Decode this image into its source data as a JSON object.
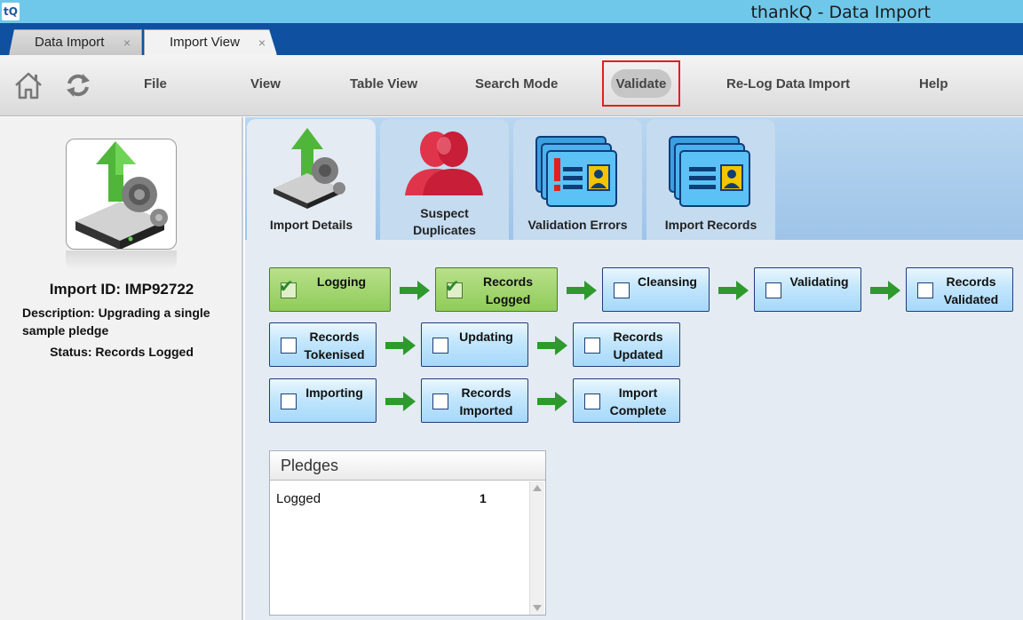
{
  "window": {
    "logo_text": "tQ",
    "title": "thankQ - Data Import"
  },
  "doc_tabs": [
    {
      "label": "Data Import",
      "close": "×"
    },
    {
      "label": "Import View",
      "close": "×"
    }
  ],
  "menu": {
    "items": {
      "file": "File",
      "view": "View",
      "table_view": "Table View",
      "search_mode": "Search Mode",
      "validate": "Validate",
      "relog": "Re-Log Data Import",
      "help": "Help"
    },
    "icons": [
      "home-icon",
      "refresh-icon"
    ]
  },
  "import": {
    "id_line": "Import ID: IMP92722",
    "description_line1": "Description: Upgrading a single",
    "description_line2": "sample pledge",
    "status_line": "Status: Records Logged"
  },
  "view_tabs": [
    {
      "label": "Import Details",
      "icon": "import-details-icon"
    },
    {
      "label1": "Suspect",
      "label2": "Duplicates",
      "icon": "suspect-duplicates-icon"
    },
    {
      "label": "Validation Errors",
      "icon": "validation-errors-icon"
    },
    {
      "label": "Import Records",
      "icon": "import-records-icon"
    }
  ],
  "workflow": {
    "logging": {
      "label": "Logging",
      "done": true
    },
    "records_logged": {
      "label1": "Records",
      "label2": "Logged",
      "done": true
    },
    "cleansing": {
      "label": "Cleansing",
      "done": false
    },
    "validating": {
      "label": "Validating",
      "done": false
    },
    "records_validated": {
      "label1": "Records",
      "label2": "Validated",
      "done": false
    },
    "records_tokenised": {
      "label1": "Records",
      "label2": "Tokenised",
      "done": false
    },
    "updating": {
      "label": "Updating",
      "done": false
    },
    "records_updated": {
      "label1": "Records",
      "label2": "Updated",
      "done": false
    },
    "importing": {
      "label": "Importing",
      "done": false
    },
    "records_imported": {
      "label1": "Records",
      "label2": "Imported",
      "done": false
    },
    "import_complete": {
      "label1": "Import",
      "label2": "Complete",
      "done": false
    },
    "tick_glyph": "✔"
  },
  "pledges": {
    "title": "Pledges",
    "rows": [
      {
        "label": "Logged",
        "count": "1"
      }
    ]
  },
  "colors": {
    "title_bar": "#6fc8ea",
    "tab_strip": "#1050a0",
    "validate_highlight": "#e02020",
    "step_done": "#8fcc5a",
    "step_pending": "#a6d8fa",
    "arrow": "#2e9a2e"
  }
}
